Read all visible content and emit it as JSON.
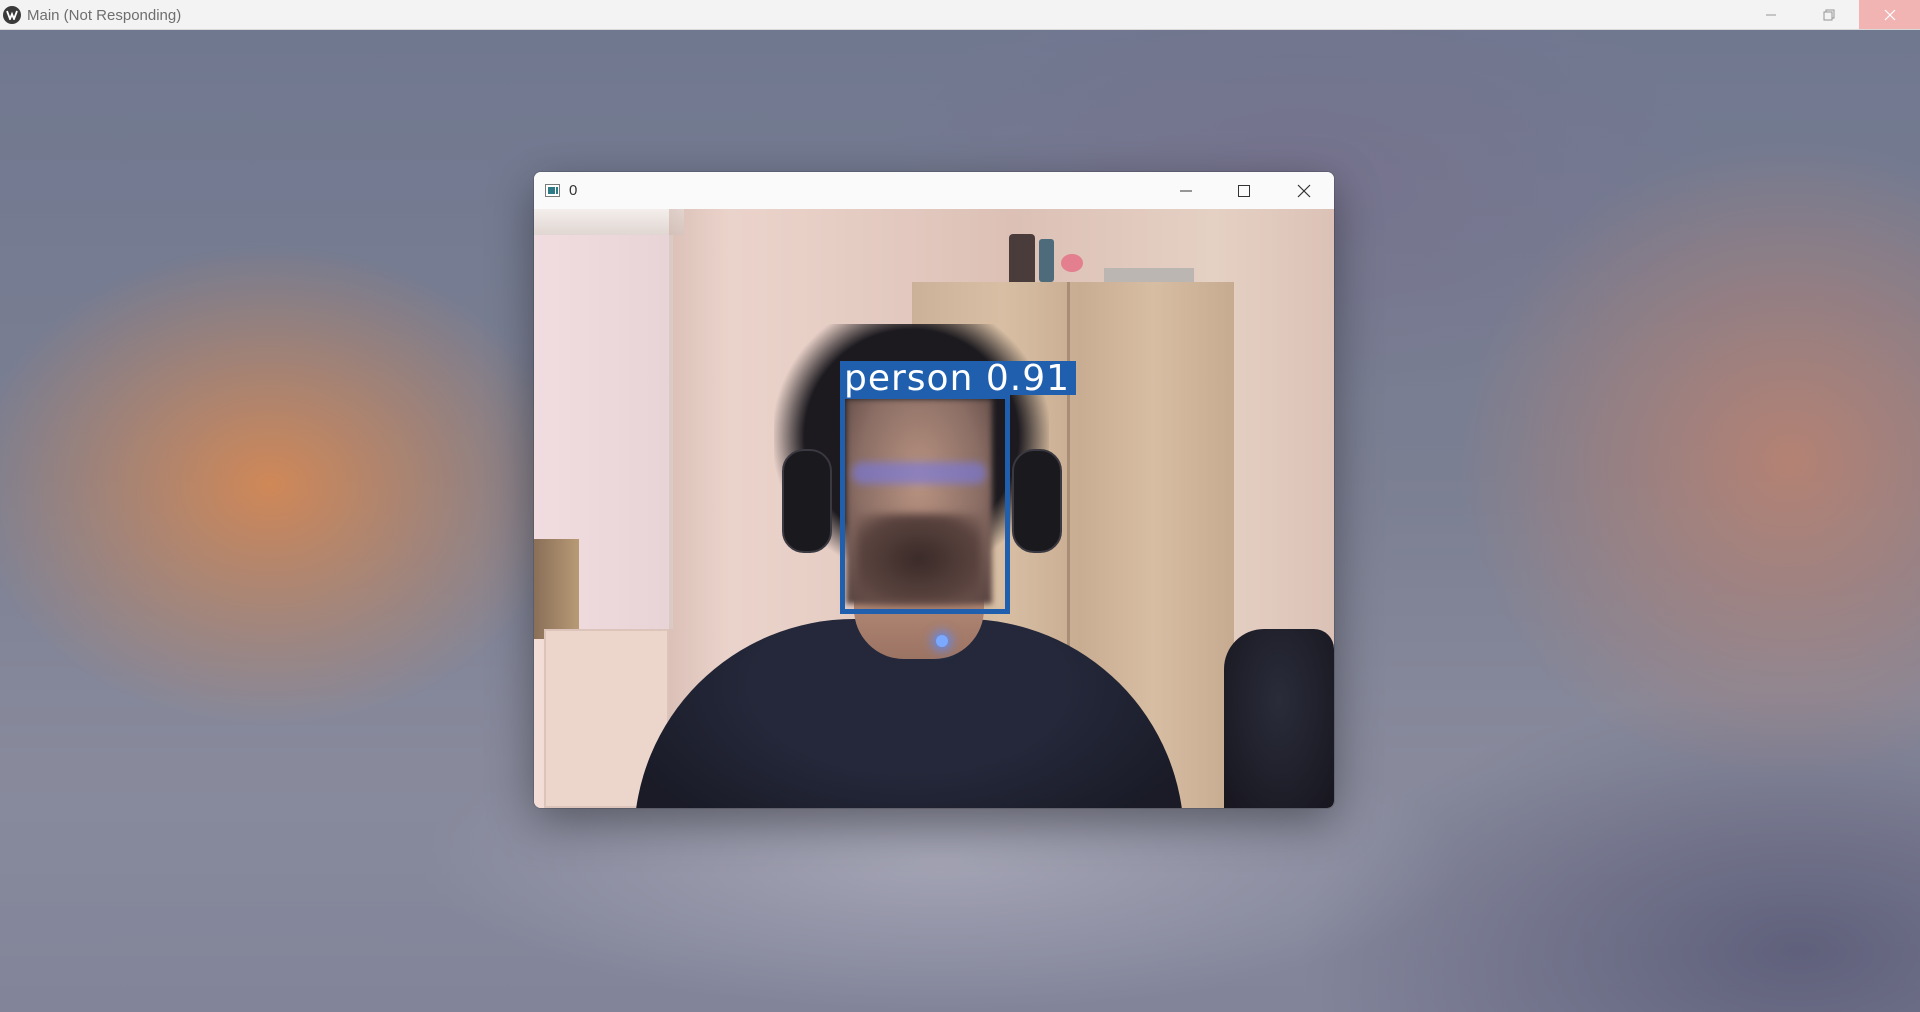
{
  "main_window": {
    "title": "Main (Not Responding)",
    "controls": [
      "minimize-icon",
      "restore-icon",
      "close-icon"
    ]
  },
  "camera_window": {
    "title": "0",
    "controls": [
      "minimize-icon",
      "maximize-icon",
      "close-icon"
    ]
  },
  "detection": {
    "label": "person 0.91",
    "class": "person",
    "confidence": 0.91,
    "box_color": "#1f5fae"
  }
}
